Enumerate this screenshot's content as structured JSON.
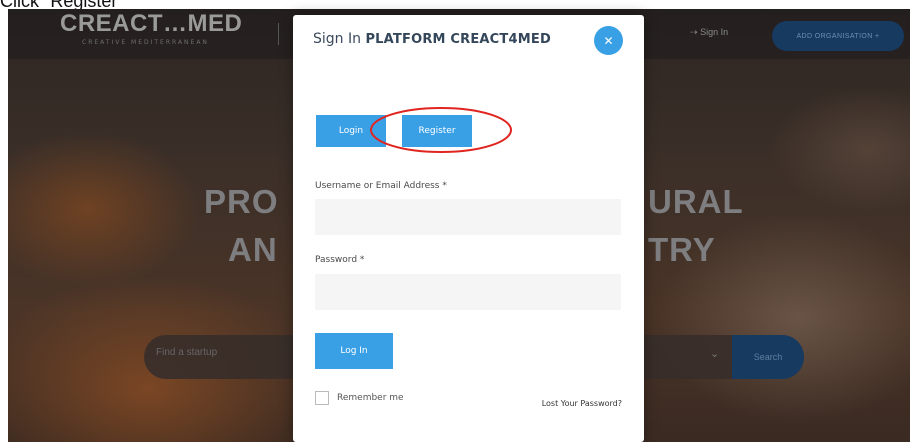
{
  "caption": "Click \"Register\"",
  "site": {
    "logo": {
      "text": "CREACT…MED",
      "subtitle": "CREATIVE MEDITERRANEAN"
    },
    "header": {
      "signin_label": "Sign In",
      "signin_icon": "sign-in-arrow-icon",
      "add_org_label": "ADD ORGANISATION +"
    },
    "hero": {
      "line1_left": "PRO",
      "line1_right": "URAL",
      "line2_left": "AN",
      "line2_right": "TRY"
    },
    "search": {
      "placeholder": "Find a startup",
      "dropdown_icon": "chevron-down-icon",
      "button_label": "Search"
    }
  },
  "modal": {
    "title_prefix": "Sign In",
    "title_bold": "PLATFORM CREACT4MED",
    "close_icon": "close-icon",
    "tabs": {
      "login": "Login",
      "register": "Register"
    },
    "username_label": "Username or Email Address *",
    "username_value": "",
    "password_label": "Password *",
    "password_value": "",
    "submit_label": "Log In",
    "remember_label": "Remember me",
    "remember_checked": false,
    "lost_password": "Lost Your Password?"
  },
  "annotation": {
    "shape": "ellipse",
    "color": "#e0241f",
    "target": "Register"
  },
  "colors": {
    "accent": "#3aa0e6",
    "title": "#34465a",
    "overlay_button": "#163a60"
  }
}
